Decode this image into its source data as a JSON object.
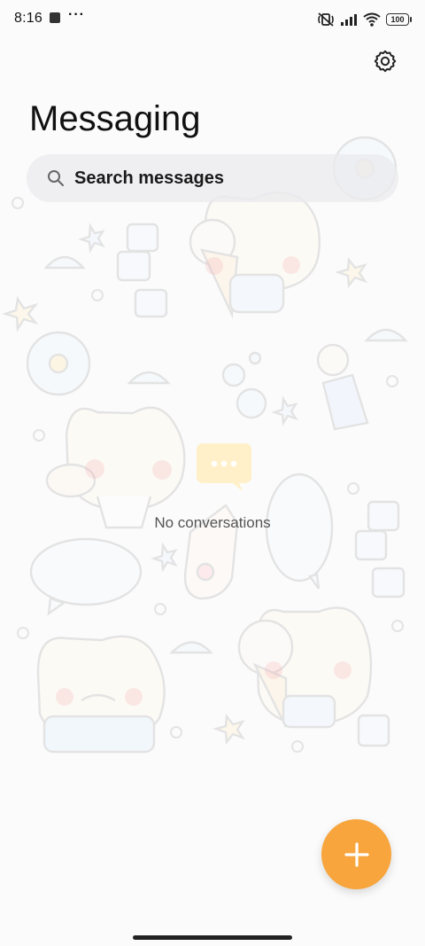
{
  "status_bar": {
    "time": "8:16",
    "more": "···",
    "battery": "100",
    "icons": [
      "notification-icon",
      "mute-vibrate-icon",
      "signal-icon",
      "wifi-icon",
      "battery-icon"
    ]
  },
  "header": {
    "title": "Messaging",
    "settings_icon": "gear-icon"
  },
  "search": {
    "placeholder": "Search messages",
    "icon": "search-icon"
  },
  "empty_state": {
    "message": "No conversations",
    "icon": "chat-bubble-icon"
  },
  "fab": {
    "icon": "plus-icon"
  },
  "colors": {
    "accent": "#f7a53c",
    "title_text": "#111111",
    "search_background": "#ebecee",
    "empty_text": "#555555"
  }
}
